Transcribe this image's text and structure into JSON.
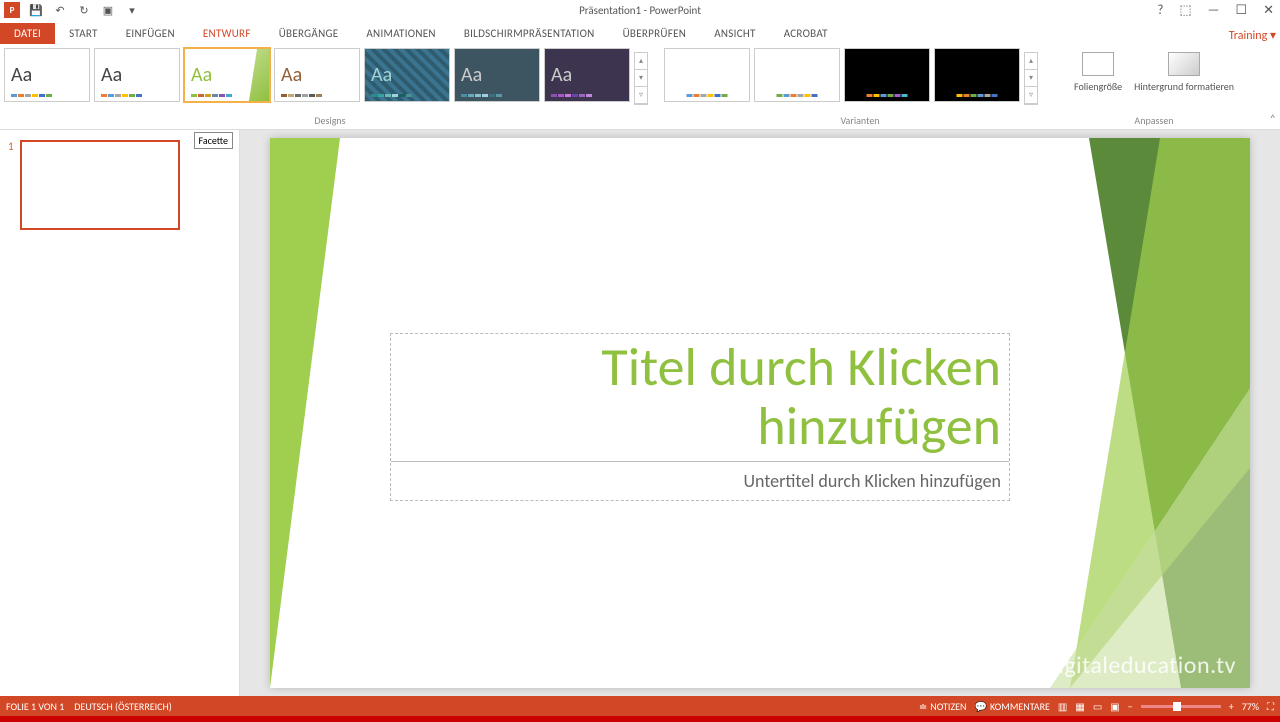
{
  "title": "Präsentation1 - PowerPoint",
  "training": "Training",
  "tabs": {
    "file": "DATEI",
    "start": "START",
    "einfuegen": "EINFÜGEN",
    "entwurf": "ENTWURF",
    "uebergaenge": "ÜBERGÄNGE",
    "animationen": "ANIMATIONEN",
    "bildschirm": "BILDSCHIRMPRÄSENTATION",
    "ueberpruefen": "ÜBERPRÜFEN",
    "ansicht": "ANSICHT",
    "acrobat": "ACROBAT"
  },
  "groups": {
    "designs": "Designs",
    "varianten": "Varianten",
    "anpassen": "Anpassen"
  },
  "anpassen": {
    "foliengroesse": "Foliengröße",
    "hintergrund": "Hintergrund formatieren"
  },
  "tooltip": "Facette",
  "slide": {
    "number": "1",
    "title_placeholder": "Titel durch Klicken hinzufügen",
    "subtitle_placeholder": "Untertitel durch Klicken hinzufügen"
  },
  "watermark": "digitaleducation.tv",
  "status": {
    "folie": "FOLIE 1 VON 1",
    "lang": "DEUTSCH (ÖSTERREICH)",
    "notizen": "NOTIZEN",
    "kommentare": "KOMMENTARE",
    "zoom": "77%"
  },
  "design_colors": {
    "d1": [
      "#5b9bd5",
      "#ed7d31",
      "#a5a5a5",
      "#ffc000",
      "#4472c4",
      "#70ad47"
    ],
    "d2": [
      "#ed7d31",
      "#5b9bd5",
      "#a5a5a5",
      "#ffc000",
      "#70ad47",
      "#4472c4"
    ],
    "d3": [
      "#90c040",
      "#c63",
      "#d4a017",
      "#6688aa",
      "#8855aa",
      "#44aacc"
    ],
    "d4": [
      "#926036",
      "#c0a878",
      "#6c6c6c",
      "#a0a0a0",
      "#5a5a5a",
      "#9c8060"
    ],
    "d5": [
      "#2e8b8b",
      "#3aa0a0",
      "#6bb8b8",
      "#a0d4d4",
      "#1a6060",
      "#4a9090"
    ],
    "d6": [
      "#4a90a4",
      "#6ba8b8",
      "#88c0d0",
      "#a0d0dd",
      "#3a7080",
      "#5a98a8"
    ],
    "d7": [
      "#8855aa",
      "#aa55cc",
      "#cc77dd",
      "#6644aa",
      "#9966bb",
      "#bb88dd"
    ]
  },
  "variant_colors": {
    "v1": [
      "#5b9bd5",
      "#ed7d31",
      "#a5a5a5",
      "#ffc000",
      "#4472c4",
      "#70ad47"
    ],
    "v2": [
      "#70ad47",
      "#5b9bd5",
      "#ed7d31",
      "#a5a5a5",
      "#ffc000",
      "#4472c4"
    ],
    "v3": [
      "#ed7d31",
      "#ffc000",
      "#5b9bd5",
      "#70ad47",
      "#9e5ecc",
      "#44bbcc"
    ],
    "v4": [
      "#ffc000",
      "#ed7d31",
      "#70ad47",
      "#5b9bd5",
      "#a5a5a5",
      "#4472c4"
    ]
  }
}
